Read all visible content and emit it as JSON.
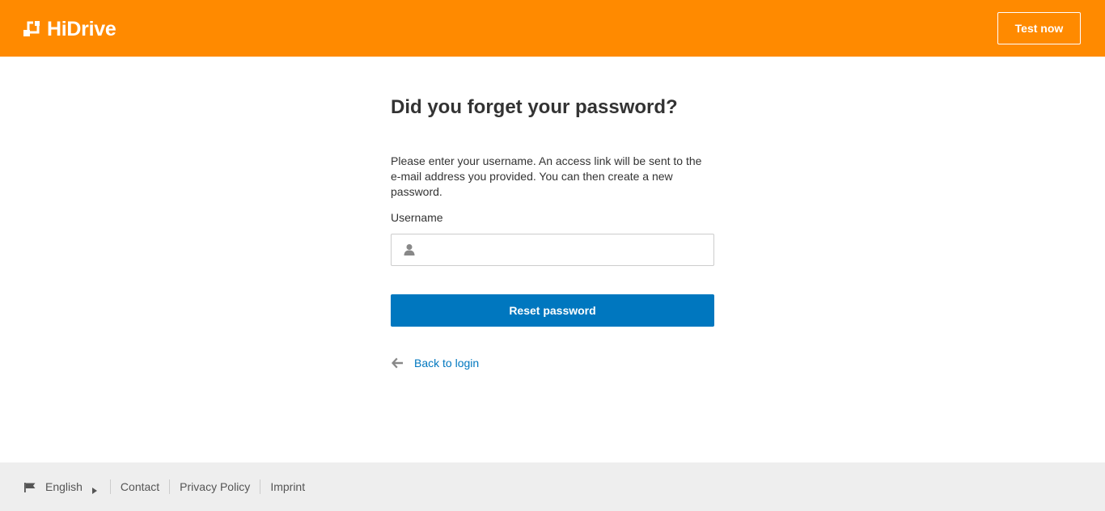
{
  "header": {
    "logo_text": "HiDrive",
    "test_now_label": "Test now",
    "bg_color": "#ff8a00"
  },
  "main": {
    "title": "Did you forget your password?",
    "description": "Please enter your username. An access link will be sent to the e-mail address you provided. You can then create a new password.",
    "username_label": "Username",
    "username_value": "",
    "username_icon": "user-icon",
    "reset_button_label": "Reset password",
    "reset_button_color": "#0077bf",
    "back_icon": "arrow-left-icon",
    "back_link_label": "Back to login"
  },
  "footer": {
    "language_icon": "flag-icon",
    "language_label": "English",
    "language_caret_icon": "caret-right-icon",
    "links": [
      "Contact",
      "Privacy Policy",
      "Imprint"
    ]
  }
}
